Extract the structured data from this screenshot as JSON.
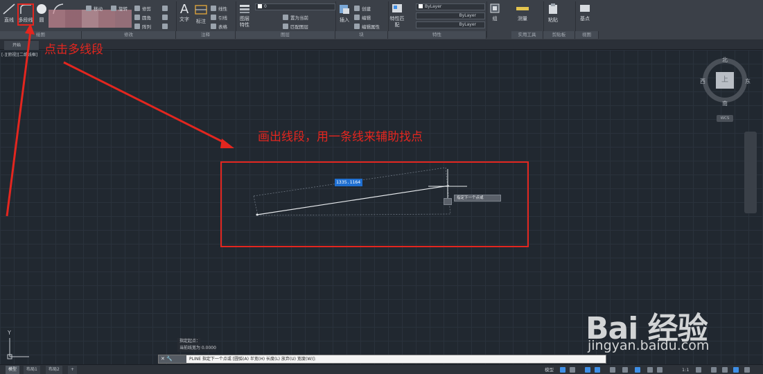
{
  "ribbon": {
    "draw_panel": {
      "title": "绘图",
      "line": "直线",
      "polyline": "多段线",
      "circle": "圆"
    },
    "modify_panel": {
      "title": "修改",
      "move": "移动",
      "rotate": "旋转",
      "trim": "修剪",
      "fillet": "圆角",
      "array": "阵列"
    },
    "annotation_panel": {
      "title": "注释",
      "text": "文字",
      "dimension": "标注",
      "linear": "线性",
      "leader": "引线",
      "table": "表格"
    },
    "layers_panel": {
      "title": "图层",
      "layer_props": "图层特性",
      "set_current": "置为当前",
      "match_layer": "匹配图层",
      "layer_value": "0"
    },
    "block_panel": {
      "title": "块",
      "insert": "插入",
      "create": "创建",
      "edit": "编辑",
      "edit_attr": "编辑属性"
    },
    "properties_panel": {
      "title": "特性",
      "match": "特性匹配",
      "color": "ByLayer",
      "linetype": "ByLayer",
      "lineweight": "ByLayer"
    },
    "utilities_panel": {
      "title": "实用工具",
      "measure": "测量"
    },
    "clipboard_panel": {
      "title": "剪贴板",
      "paste": "粘贴"
    },
    "view_panel": {
      "title": "视图",
      "base": "基点"
    },
    "group_label": "组"
  },
  "tabs": {
    "start": "开始"
  },
  "viewport": {
    "label": "[-][俯视][二维线框]",
    "dimension_value": "1335.1164",
    "prompt_tip": "指定下一个点或"
  },
  "viewcube": {
    "north": "北",
    "south": "南",
    "east": "东",
    "west": "西",
    "face": "上",
    "wcs": "WCS"
  },
  "annotations": {
    "click_polyline": "点击多线段",
    "draw_segment": "画出线段，用一条线来辅助找点"
  },
  "ucs": {
    "y": "Y"
  },
  "command": {
    "history": [
      "指定起点：",
      "当前线宽为 0.0000"
    ],
    "ctrl": "✕ 🔧",
    "prompt": "PLINE 指定下一个点或 [圆弧(A) 半宽(H) 长度(L) 放弃(U) 宽度(W)]:"
  },
  "statusbar": {
    "layouts": [
      "模型",
      "布局1",
      "布局2"
    ],
    "add_layout": "+",
    "model": "模型",
    "scale": "1:1"
  },
  "watermark": {
    "brand": "Bai 经验",
    "url": "jingyan.baidu.com"
  },
  "colors": {
    "annotation": "#e3261f",
    "canvas": "#212830",
    "ribbon": "#3b4048",
    "dim_input": "#1f6fd1"
  }
}
